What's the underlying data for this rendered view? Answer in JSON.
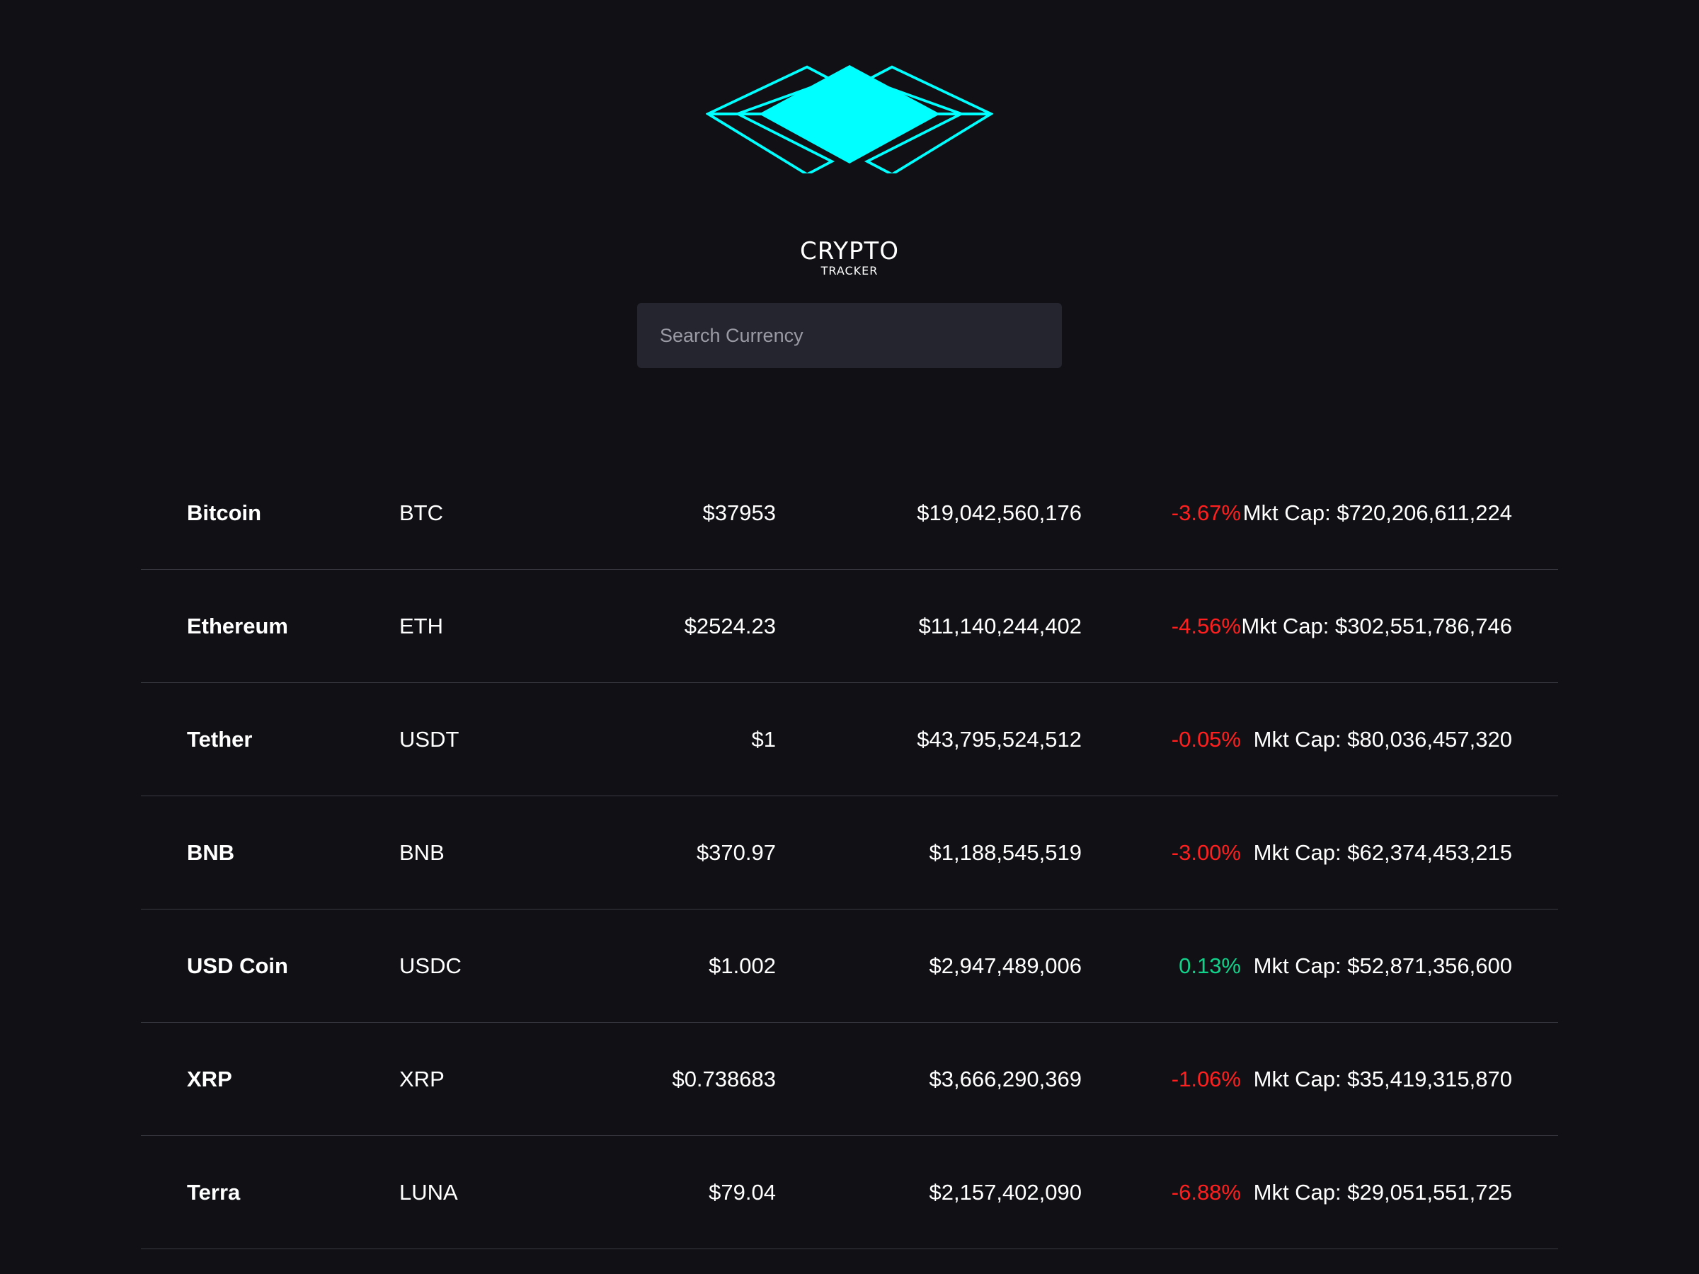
{
  "brand": {
    "title": "CRYPTO",
    "subtitle": "TRACKER",
    "accent_color": "#00FFFF"
  },
  "search": {
    "placeholder": "Search Currency",
    "value": ""
  },
  "coins": [
    {
      "name": "Bitcoin",
      "symbol": "BTC",
      "price": "$37953",
      "volume": "$19,042,560,176",
      "change": "-3.67%",
      "direction": "negative",
      "market_cap": "Mkt Cap: $720,206,611,224"
    },
    {
      "name": "Ethereum",
      "symbol": "ETH",
      "price": "$2524.23",
      "volume": "$11,140,244,402",
      "change": "-4.56%",
      "direction": "negative",
      "market_cap": "Mkt Cap: $302,551,786,746"
    },
    {
      "name": "Tether",
      "symbol": "USDT",
      "price": "$1",
      "volume": "$43,795,524,512",
      "change": "-0.05%",
      "direction": "negative",
      "market_cap": "Mkt Cap: $80,036,457,320"
    },
    {
      "name": "BNB",
      "symbol": "BNB",
      "price": "$370.97",
      "volume": "$1,188,545,519",
      "change": "-3.00%",
      "direction": "negative",
      "market_cap": "Mkt Cap: $62,374,453,215"
    },
    {
      "name": "USD Coin",
      "symbol": "USDC",
      "price": "$1.002",
      "volume": "$2,947,489,006",
      "change": "0.13%",
      "direction": "positive",
      "market_cap": "Mkt Cap: $52,871,356,600"
    },
    {
      "name": "XRP",
      "symbol": "XRP",
      "price": "$0.738683",
      "volume": "$3,666,290,369",
      "change": "-1.06%",
      "direction": "negative",
      "market_cap": "Mkt Cap: $35,419,315,870"
    },
    {
      "name": "Terra",
      "symbol": "LUNA",
      "price": "$79.04",
      "volume": "$2,157,402,090",
      "change": "-6.88%",
      "direction": "negative",
      "market_cap": "Mkt Cap: $29,051,551,725"
    }
  ],
  "colors": {
    "background": "#111115",
    "negative": "#FF1F1F",
    "positive": "#11D28B",
    "divider": "#3A3A42"
  }
}
